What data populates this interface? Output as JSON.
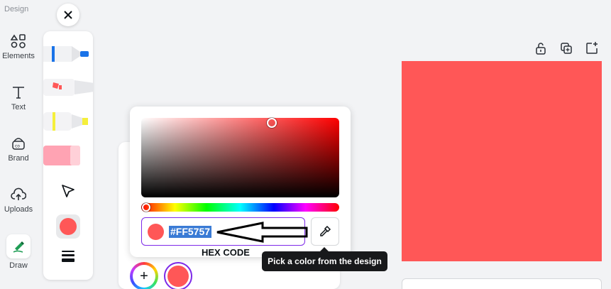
{
  "rail": {
    "top_label": "Design",
    "items": [
      {
        "label": "Elements",
        "icon": "elements-icon"
      },
      {
        "label": "Text",
        "icon": "text-icon"
      },
      {
        "label": "Brand",
        "icon": "brand-icon"
      },
      {
        "label": "Uploads",
        "icon": "uploads-icon"
      },
      {
        "label": "Draw",
        "icon": "draw-icon"
      }
    ]
  },
  "tools": {
    "pens": [
      {
        "name": "pen",
        "color": "#1a73e8"
      },
      {
        "name": "marker",
        "color": "#ff5757"
      },
      {
        "name": "highlighter",
        "color": "#f5ef3b"
      },
      {
        "name": "eraser",
        "color": "#ffa3b3"
      }
    ],
    "selected_color": "#ff5757"
  },
  "picker": {
    "hex_value": "#FF5757",
    "hue_color": "#ff0000",
    "annotation": "HEX CODE"
  },
  "tooltip": {
    "text": "Pick a color from the design"
  },
  "swatches": [
    {
      "kind": "add",
      "label": "+"
    },
    {
      "kind": "color",
      "color": "#ff5757",
      "selected": true
    }
  ],
  "canvas": {
    "fill": "#ff5757"
  }
}
